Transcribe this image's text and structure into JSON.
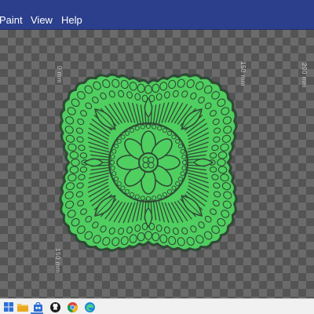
{
  "menu": {
    "items": [
      {
        "label": "Paint"
      },
      {
        "label": "View"
      },
      {
        "label": "Help"
      }
    ]
  },
  "canvas": {
    "rulers": {
      "label_0": "0 mm",
      "label_150_top": "150 mm",
      "label_200": "200 mm",
      "label_150_bottom": "150 mm"
    },
    "colors": {
      "fill": "#4fcf5f",
      "outline": "#2f4a36",
      "checker_light": "#6b6b6b",
      "checker_dark": "#545454"
    }
  },
  "taskbar": {
    "icons": [
      "windows-start-icon",
      "file-explorer-icon",
      "app-store-icon",
      "github-icon",
      "chrome-icon",
      "edge-icon"
    ]
  }
}
